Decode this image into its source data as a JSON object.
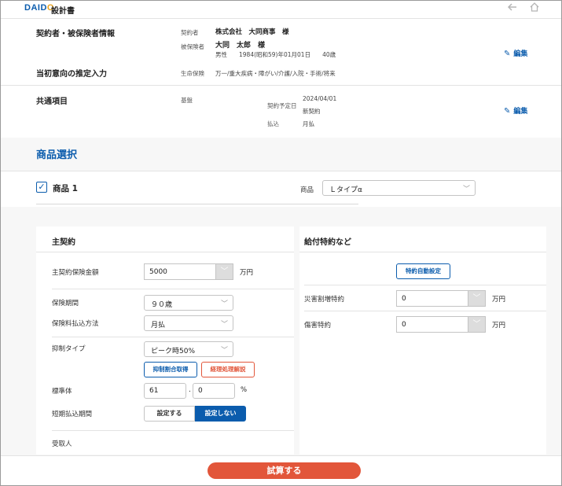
{
  "header": {
    "logo": "DAIDO",
    "title": "設計書",
    "back_icon": "arrow-left-icon",
    "home_icon": "home-icon"
  },
  "contract_section": {
    "heading": "契約者・被保険者情報",
    "contractor_label": "契約者",
    "contractor_value": "株式会社　大同商事　様",
    "insured_label": "被保険者",
    "insured_name": "大同　太郎　様",
    "insured_detail": "男性　　1984(昭和59)年01月01日　　40歳",
    "edit_label": "編集"
  },
  "intention_section": {
    "heading": "当初意向の推定入力",
    "label": "生命保険",
    "value": "万一/重大疾病・障がい/介護/入院・手術/将来"
  },
  "common_section": {
    "heading": "共通項目",
    "base_label": "基盤",
    "date_label": "契約予定日",
    "date_value": "2024/04/01",
    "contract_type": "新契約",
    "payment_label": "払込",
    "payment_value": "月払",
    "edit_label": "編集"
  },
  "product_select": {
    "heading": "商品選択",
    "product_label": "商品 1",
    "product_checked": true,
    "product_field_label": "商品",
    "product_value": "Ｌタイプα"
  },
  "main_contract": {
    "heading": "主契約",
    "amount_label": "主契約保険金額",
    "amount_value": "5000",
    "amount_unit": "万円",
    "period_label": "保険期間",
    "period_value": "９０歳",
    "pay_method_label": "保険料払込方法",
    "pay_method_value": "月払",
    "control_type_label": "抑制タイプ",
    "control_type_value": "ピーク時50%",
    "control_rate_button": "抑制割合取得",
    "accounting_button": "経理処理解説",
    "standard_label": "標準体",
    "standard_int": "61",
    "standard_dec": "0",
    "standard_unit": "%",
    "short_pay_label": "短期払込期間",
    "short_pay_set": "設定する",
    "short_pay_unset": "設定しない",
    "beneficiary_label": "受取人"
  },
  "riders": {
    "heading": "給付特約など",
    "auto_button": "特約自動設定",
    "disaster_label": "災害割増特約",
    "disaster_value": "0",
    "disaster_unit": "万円",
    "injury_label": "傷害特約",
    "injury_value": "0",
    "injury_unit": "万円"
  },
  "footer": {
    "calculate_button": "試算する"
  },
  "colors": {
    "brand_blue": "#0b5cad",
    "accent_orange": "#e2563a",
    "logo_orange": "#e8a21c"
  }
}
